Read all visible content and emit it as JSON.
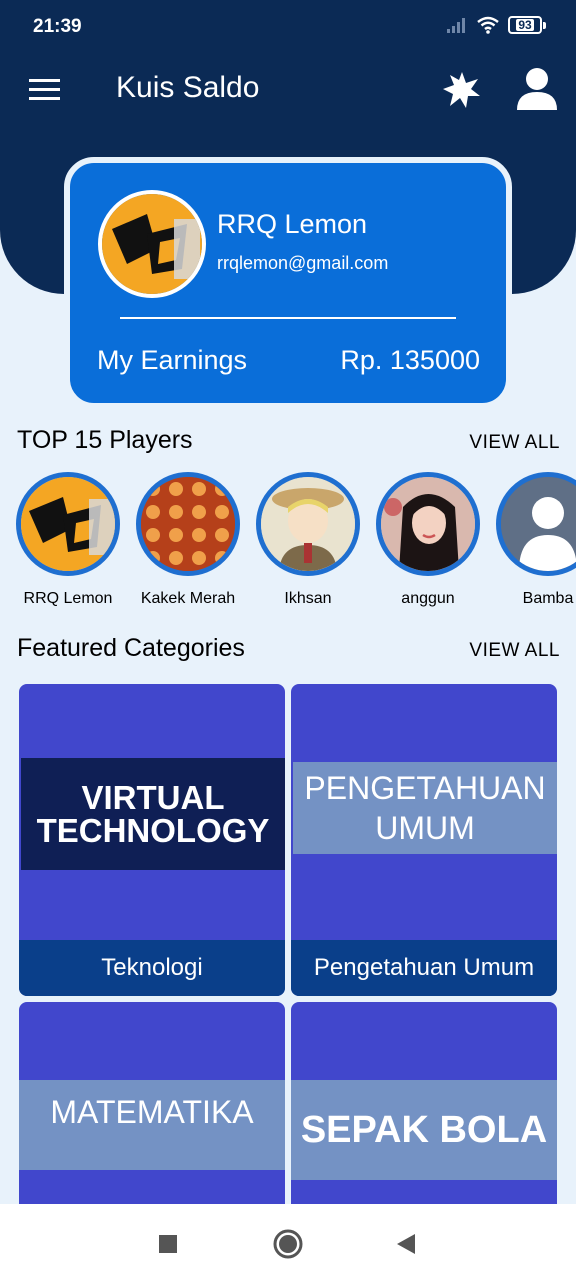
{
  "status_bar": {
    "time": "21:39",
    "battery": "93"
  },
  "app_bar": {
    "title": "Kuis Saldo"
  },
  "profile": {
    "name": "RRQ Lemon",
    "email": "rrqlemon@gmail.com",
    "earnings_label": "My Earnings",
    "earnings_value": "Rp. 135000"
  },
  "players_section": {
    "title": "TOP 15 Players",
    "view_all": "VIEW ALL",
    "players": [
      {
        "name": "RRQ Lemon"
      },
      {
        "name": "Kakek Merah"
      },
      {
        "name": "Ikhsan"
      },
      {
        "name": "anggun"
      },
      {
        "name": "Bamba"
      }
    ]
  },
  "categories_section": {
    "title": "Featured Categories",
    "view_all": "VIEW ALL",
    "categories": [
      {
        "label": "Teknologi",
        "banner_line1": "VIRTUAL",
        "banner_line2": "TECHNOLOGY"
      },
      {
        "label": "Pengetahuan Umum",
        "banner_line1": "PENGETAHUAN",
        "banner_line2": "UMUM"
      },
      {
        "label": "",
        "banner_line1": "MATEMATIKA",
        "banner_line2": ""
      },
      {
        "label": "",
        "banner_line1": "SEPAK BOLA",
        "banner_line2": ""
      }
    ]
  },
  "colors": {
    "header": "#0b2a55",
    "card": "#0a6ed9",
    "background": "#e8f2fb",
    "category_card": "#4147cc",
    "category_label": "#0a3f8a"
  },
  "icons": [
    "menu-icon",
    "brightness-icon",
    "account-icon",
    "signal-icon",
    "wifi-icon",
    "battery-icon",
    "recents-icon",
    "home-icon",
    "back-icon"
  ]
}
